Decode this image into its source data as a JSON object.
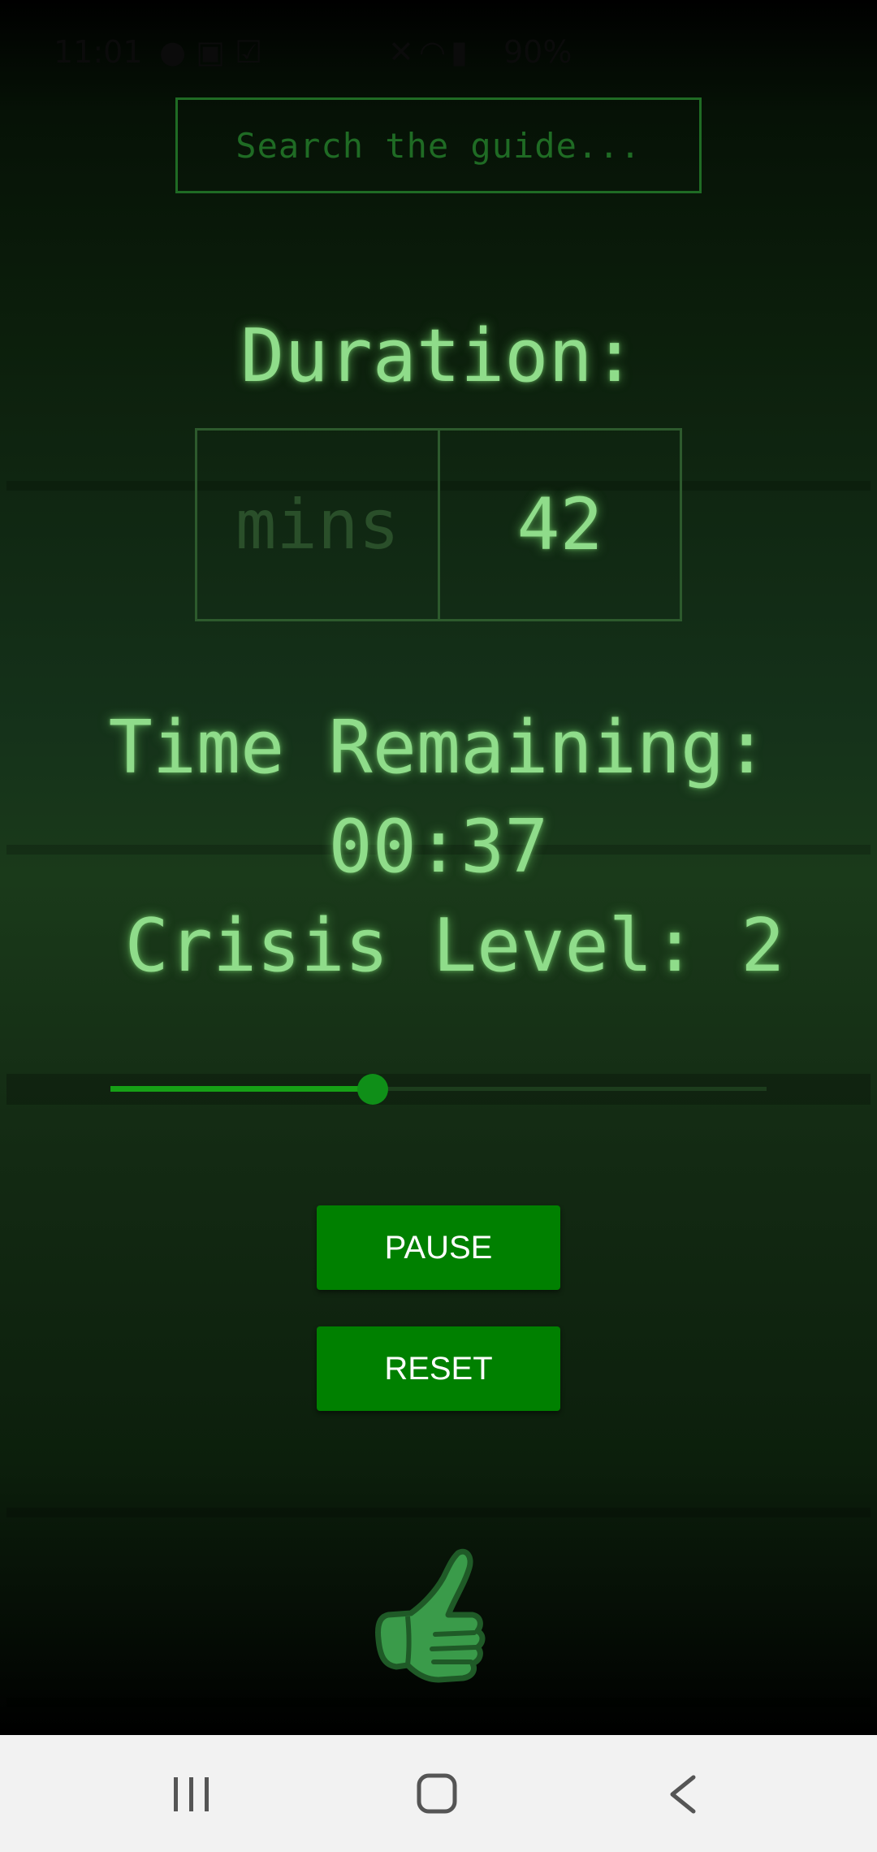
{
  "status_bar": {
    "time": "11:01",
    "left_icons": [
      "notification-icon",
      "image-icon",
      "check-icon"
    ],
    "right_icons": [
      "mute-icon",
      "wifi-icon",
      "signal-icon"
    ],
    "battery": "90%"
  },
  "search": {
    "placeholder": "Search the guide..."
  },
  "duration": {
    "label": "Duration:",
    "unit": "mins",
    "value": "42"
  },
  "timer": {
    "label": "Time Remaining:",
    "value": "00:37"
  },
  "crisis": {
    "label": "Crisis Level: 2",
    "slider_fraction": 0.4
  },
  "buttons": {
    "pause": "PAUSE",
    "reset": "RESET"
  },
  "icons": {
    "feedback": "thumbs-up-icon"
  },
  "nav": {
    "recents": "recents-icon",
    "home": "home-icon",
    "back": "back-icon"
  },
  "colors": {
    "accent": "#008000",
    "text_glow": "#8fdc8a",
    "dim": "#2a4f2a",
    "thumb": "#3a9b4a"
  }
}
